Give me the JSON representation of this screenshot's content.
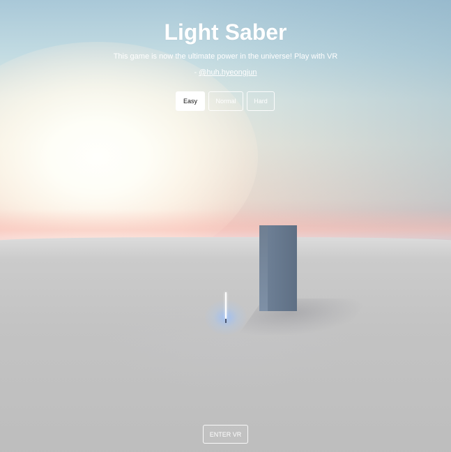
{
  "header": {
    "title": "Light Saber",
    "tagline": "This game is now the ultimate power in the universe! Play with VR",
    "credit_prefix": "- ",
    "credit_handle": "@huh.hyeongjun"
  },
  "difficulty": {
    "options": [
      "Easy",
      "Normal",
      "Hard"
    ],
    "selected": "Easy"
  },
  "vr": {
    "enter_label": "ENTER VR"
  },
  "colors": {
    "block": "#66788d",
    "saber_blade": "#ffffff",
    "saber_glow": "#9cc0ff",
    "ground": "#c3c3c3"
  }
}
